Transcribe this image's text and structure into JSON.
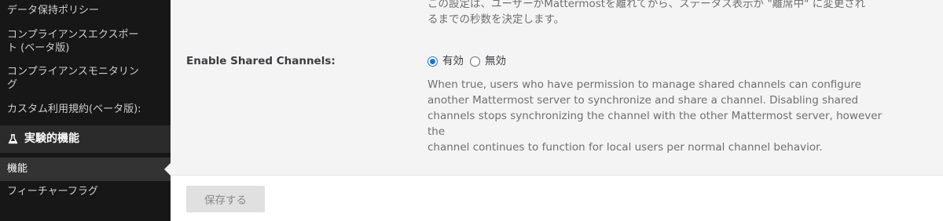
{
  "sidebar": {
    "items": [
      {
        "label": "データ保持ポリシー"
      },
      {
        "label": "コンプライアンスエクスポー"
      },
      {
        "label": "ト (ベータ版)"
      },
      {
        "label": "コンプライアンスモニタリン"
      },
      {
        "label": "グ"
      },
      {
        "label": "カスタム利用規約(ベータ版):"
      }
    ],
    "section": {
      "label": "実験的機能",
      "icon": "flask-icon"
    },
    "active_item": {
      "label": "機能"
    },
    "after_items": [
      {
        "label": "フィーチャーフラグ"
      }
    ]
  },
  "main": {
    "previous_help": [
      "この設定は、ユーザーがMattermostを離れてから、ステータス表示が \"離席中\" に変更され",
      "るまでの秒数を決定します。"
    ],
    "setting": {
      "label": "Enable Shared Channels:",
      "options": [
        {
          "label": "有効",
          "checked": true
        },
        {
          "label": "無効",
          "checked": false
        }
      ],
      "help": [
        "When true, users who have permission to manage shared channels can configure",
        "another Mattermost server to synchronize and share a channel. Disabling shared",
        "channels stops synchronizing the channel with the other Mattermost server, however the",
        "channel continues to function for local users per normal channel behavior."
      ]
    }
  },
  "footer": {
    "save_label": "保存する"
  },
  "colors": {
    "sidebar_bg": "#171717",
    "radio_accent": "#1e72d6",
    "save_disabled_bg": "#e0e0e0"
  }
}
